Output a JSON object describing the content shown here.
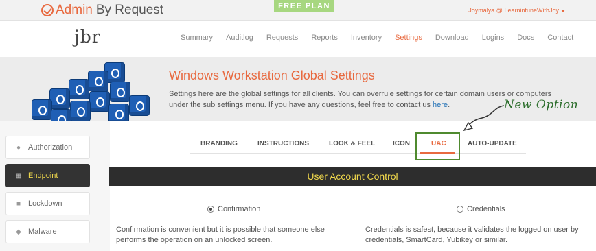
{
  "brand": {
    "name_part1": "Admin",
    "name_part2": "By Request",
    "plan_badge": "FREE PLAN"
  },
  "user": {
    "account": "Joymalya @ LearnintuneWithJoy"
  },
  "navbar": {
    "logo": "jbr",
    "items": [
      {
        "label": "Summary"
      },
      {
        "label": "Auditlog"
      },
      {
        "label": "Requests"
      },
      {
        "label": "Reports"
      },
      {
        "label": "Inventory"
      },
      {
        "label": "Settings",
        "active": true
      },
      {
        "label": "Download"
      },
      {
        "label": "Logins"
      },
      {
        "label": "Docs"
      },
      {
        "label": "Contact"
      }
    ]
  },
  "hero": {
    "title": "Windows Workstation Global Settings",
    "text": "Settings here are the global settings for all clients. You can overrule settings for certain domain users or computers under the sub settings menu. If you have any questions, feel free to contact us",
    "link": "here",
    "after_link": "."
  },
  "annotation": {
    "text": "New Option"
  },
  "sidebar": {
    "items": [
      {
        "label": "Authorization",
        "icon": "user-icon"
      },
      {
        "label": "Endpoint",
        "icon": "windows-icon",
        "active": true
      },
      {
        "label": "Lockdown",
        "icon": "lock-icon"
      },
      {
        "label": "Malware",
        "icon": "shield-icon"
      }
    ]
  },
  "tabs": {
    "items": [
      {
        "label": "BRANDING"
      },
      {
        "label": "INSTRUCTIONS"
      },
      {
        "label": "LOOK & FEEL"
      },
      {
        "label": "ICON"
      },
      {
        "label": "UAC",
        "active": true
      },
      {
        "label": "AUTO-UPDATE"
      }
    ]
  },
  "section": {
    "title": "User Account Control"
  },
  "options": {
    "confirmation": {
      "label": "Confirmation",
      "selected": true,
      "description": "Confirmation is convenient but it is possible that someone else performs the operation on an unlocked screen."
    },
    "credentials": {
      "label": "Credentials",
      "selected": false,
      "description": "Credentials is safest, because it validates the logged on user by credentials, SmartCard, Yubikey or similar."
    }
  },
  "colors": {
    "accent": "#e8693f",
    "dark": "#2d2d2d",
    "yellow": "#f0d84c",
    "annotation_green": "#4f8a2f",
    "plan_green": "#a7d780"
  }
}
